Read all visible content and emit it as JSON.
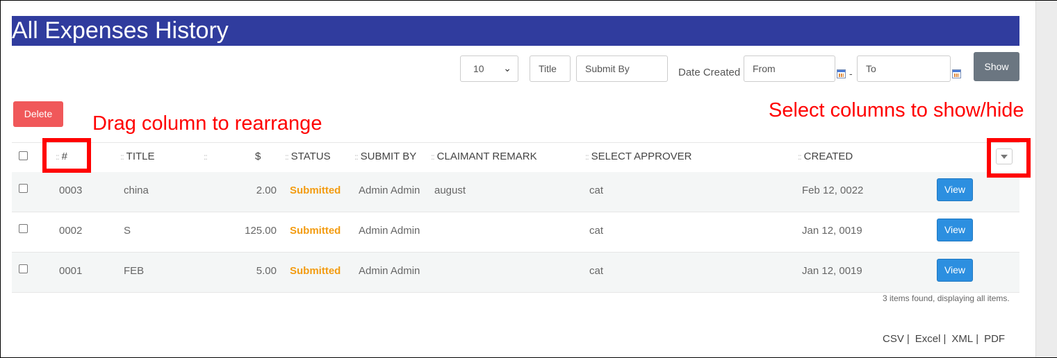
{
  "page_title": "All Expenses History",
  "filters": {
    "page_size": "10",
    "title_placeholder": "Title",
    "submit_by_placeholder": "Submit By",
    "date_created_label": "Date Created",
    "from_placeholder": "From",
    "to_placeholder": "To",
    "date_separator": "-",
    "show_label": "Show"
  },
  "actions": {
    "delete_label": "Delete"
  },
  "annotations": {
    "drag": "Drag column to rearrange",
    "select": "Select columns to show/hide"
  },
  "table": {
    "columns": [
      "#",
      "TITLE",
      "$",
      "STATUS",
      "SUBMIT BY",
      "CLAIMANT REMARK",
      "SELECT APPROVER",
      "CREATED"
    ],
    "rows": [
      {
        "id": "0003",
        "title": "china",
        "amount": "2.00",
        "status": "Submitted",
        "submit_by": "Admin Admin",
        "remark": "august",
        "approver": "cat",
        "created": "Feb 12, 0022",
        "action": "View"
      },
      {
        "id": "0002",
        "title": "S",
        "amount": "125.00",
        "status": "Submitted",
        "submit_by": "Admin Admin",
        "remark": "",
        "approver": "cat",
        "created": "Jan 12, 0019",
        "action": "View"
      },
      {
        "id": "0001",
        "title": "FEB",
        "amount": "5.00",
        "status": "Submitted",
        "submit_by": "Admin Admin",
        "remark": "",
        "approver": "cat",
        "created": "Jan 12, 0019",
        "action": "View"
      }
    ],
    "summary": "3 items found, displaying all items."
  },
  "exports": [
    "CSV",
    "Excel",
    "XML",
    "PDF"
  ],
  "colors": {
    "header_bg": "#303c9e",
    "delete_bg": "#f0585a",
    "show_bg": "#6b7681",
    "view_bg": "#2c8fe0",
    "status": "#f39c12",
    "annotation": "#ff0000"
  }
}
